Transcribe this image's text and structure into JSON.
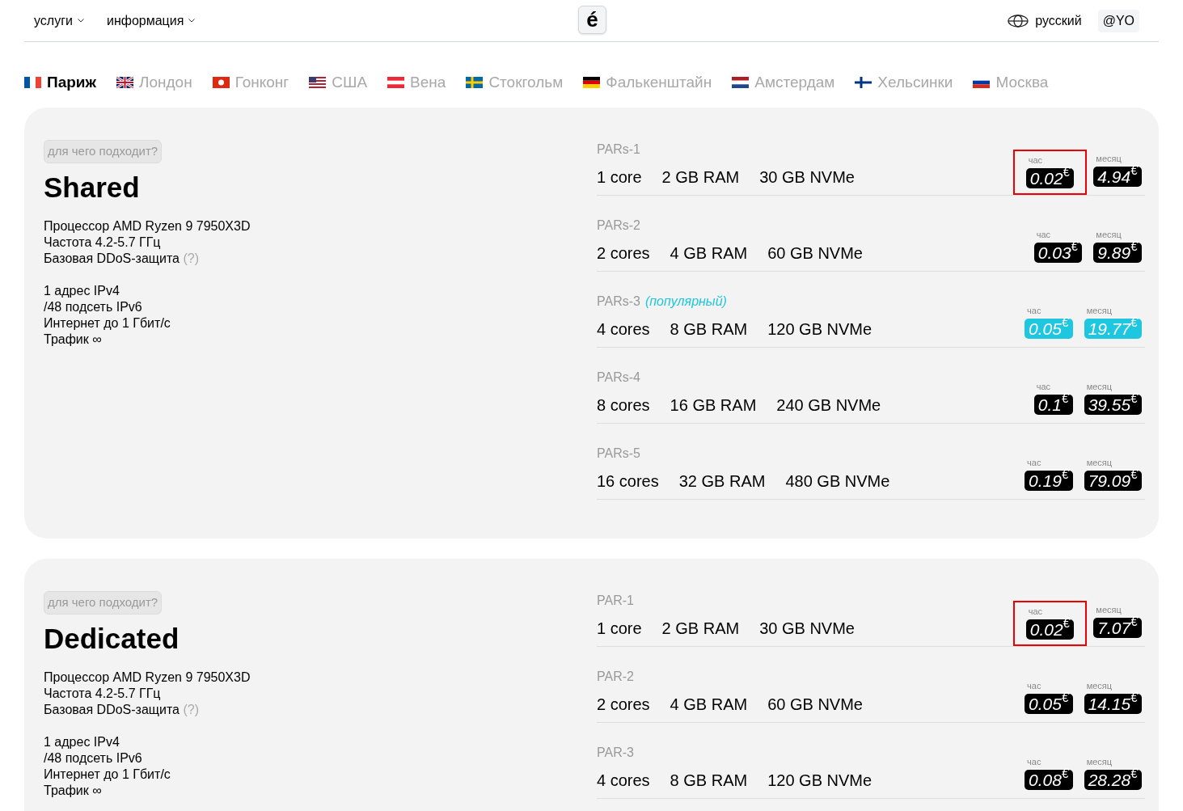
{
  "nav": {
    "menus": [
      {
        "label": "услуги"
      },
      {
        "label": "информация"
      }
    ],
    "logo": "é",
    "language": "русский",
    "user": "@YO"
  },
  "locations": [
    {
      "label": "Париж",
      "kind": "fr",
      "selected": true
    },
    {
      "label": "Лондон",
      "kind": "gb",
      "selected": false
    },
    {
      "label": "Гонконг",
      "kind": "hk",
      "selected": false
    },
    {
      "label": "США",
      "kind": "us",
      "selected": false
    },
    {
      "label": "Вена",
      "kind": "at",
      "selected": false
    },
    {
      "label": "Стокгольм",
      "kind": "se",
      "selected": false
    },
    {
      "label": "Фалькенштайн",
      "kind": "de",
      "selected": false
    },
    {
      "label": "Амстердам",
      "kind": "nl",
      "selected": false
    },
    {
      "label": "Хельсинки",
      "kind": "fi",
      "selected": false
    },
    {
      "label": "Москва",
      "kind": "ru",
      "selected": false
    }
  ],
  "sections": [
    {
      "badge": "для чего подходит?",
      "title": "Shared",
      "features": [
        [
          {
            "text": "Процессор AMD Ryzen 9 7950X3D"
          },
          {
            "text": "Частота 4.2-5.7 ГГц"
          },
          {
            "text": "Базовая DDoS-защита",
            "hint": "(?)"
          }
        ],
        [
          {
            "text": "1 адрес IPv4"
          },
          {
            "text": "/48 подсеть IPv6"
          },
          {
            "text": "Интернет до 1 Гбит/с"
          },
          {
            "text": "Трафик ∞"
          }
        ]
      ],
      "plans": [
        {
          "name": "PARs-1",
          "specs": [
            "1 core",
            "2 GB RAM",
            "30 GB NVMe"
          ],
          "hour_label": "час",
          "hour": "0.02$^{€}$",
          "month_label": "месяц",
          "month": "4.94$^{€}$",
          "popular": false,
          "highlighted": true
        },
        {
          "name": "PARs-2",
          "specs": [
            "2 cores",
            "4 GB RAM",
            "60 GB NVMe"
          ],
          "hour_label": "час",
          "hour": "0.03$^{€}$",
          "month_label": "месяц",
          "month": "9.89$^{€}$",
          "popular": false,
          "highlighted": false
        },
        {
          "name": "PARs-3",
          "tag": "(популярный)",
          "specs": [
            "4 cores",
            "8 GB RAM",
            "120 GB NVMe"
          ],
          "hour_label": "час",
          "hour": "0.05$^{€}$",
          "month_label": "месяц",
          "month": "19.77$^{€}$",
          "popular": true,
          "highlighted": false
        },
        {
          "name": "PARs-4",
          "specs": [
            "8 cores",
            "16 GB RAM",
            "240 GB NVMe"
          ],
          "hour_label": "час",
          "hour": "0.1$^{€}$",
          "month_label": "месяц",
          "month": "39.55$^{€}$",
          "popular": false,
          "highlighted": false
        },
        {
          "name": "PARs-5",
          "specs": [
            "16 cores",
            "32 GB RAM",
            "480 GB NVMe"
          ],
          "hour_label": "час",
          "hour": "0.19$^{€}$",
          "month_label": "месяц",
          "month": "79.09$^{€}$",
          "popular": false,
          "highlighted": false
        }
      ]
    },
    {
      "badge": "для чего подходит?",
      "title": "Dedicated",
      "features": [
        [
          {
            "text": "Процессор AMD Ryzen 9 7950X3D"
          },
          {
            "text": "Частота 4.2-5.7 ГГц"
          },
          {
            "text": "Базовая DDoS-защита",
            "hint": "(?)"
          }
        ],
        [
          {
            "text": "1 адрес IPv4"
          },
          {
            "text": "/48 подсеть IPv6"
          },
          {
            "text": "Интернет до 1 Гбит/с"
          },
          {
            "text": "Трафик ∞"
          }
        ]
      ],
      "plans": [
        {
          "name": "PAR-1",
          "specs": [
            "1 core",
            "2 GB RAM",
            "30 GB NVMe"
          ],
          "hour_label": "час",
          "hour": "0.02$^{€}$",
          "month_label": "месяц",
          "month": "7.07$^{€}$",
          "popular": false,
          "highlighted": true
        },
        {
          "name": "PAR-2",
          "specs": [
            "2 cores",
            "4 GB RAM",
            "60 GB NVMe"
          ],
          "hour_label": "час",
          "hour": "0.05$^{€}$",
          "month_label": "месяц",
          "month": "14.15$^{€}$",
          "popular": false,
          "highlighted": false
        },
        {
          "name": "PAR-3",
          "specs": [
            "4 cores",
            "8 GB RAM",
            "120 GB NVMe"
          ],
          "hour_label": "час",
          "hour": "0.08$^{€}$",
          "month_label": "месяц",
          "month": "28.28$^{€}$",
          "popular": false,
          "highlighted": false
        }
      ]
    }
  ]
}
